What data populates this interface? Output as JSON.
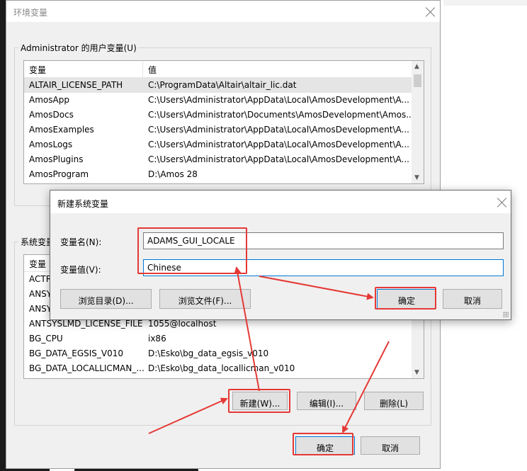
{
  "env_window": {
    "title": "环境变量",
    "user_group_label": "Administrator 的用户变量(U)",
    "system_group_label": "系统变量",
    "columns": [
      "变量",
      "值"
    ],
    "user_vars": [
      {
        "name": "ALTAIR_LICENSE_PATH",
        "value": "C:\\ProgramData\\Altair\\altair_lic.dat"
      },
      {
        "name": "AmosApp",
        "value": "C:\\Users\\Administrator\\AppData\\Local\\AmosDevelopment\\A..."
      },
      {
        "name": "AmosDocs",
        "value": "C:\\Users\\Administrator\\Documents\\AmosDevelopment\\Amos..."
      },
      {
        "name": "AmosExamples",
        "value": "C:\\Users\\Administrator\\AppData\\Local\\AmosDevelopment\\A..."
      },
      {
        "name": "AmosLogs",
        "value": "C:\\Users\\Administrator\\AppData\\Local\\AmosDevelopment\\A..."
      },
      {
        "name": "AmosPlugins",
        "value": "C:\\Users\\Administrator\\AppData\\Local\\AmosDevelopment\\A..."
      },
      {
        "name": "AmosProgram",
        "value": "D:\\Amos 28"
      }
    ],
    "system_header_first": "变量",
    "system_vars_partial": [
      "ACTR",
      "ANSY",
      "ANSY"
    ],
    "system_vars": [
      {
        "name": "ANTSYSLMD_LICENSE_FILE",
        "value": "1055@localhost"
      },
      {
        "name": "BG_CPU",
        "value": "ix86"
      },
      {
        "name": "BG_DATA_EGSIS_V010",
        "value": "D:\\Esko\\bg_data_egsis_v010"
      },
      {
        "name": "BG_DATA_LOCALLICMAN_...",
        "value": "D:\\Esko\\bg_data_locallicman_v010"
      }
    ],
    "buttons": {
      "new": "新建(W)...",
      "edit": "编辑(I)...",
      "delete": "删除(L)",
      "ok": "确定",
      "cancel": "取消"
    }
  },
  "new_var_dialog": {
    "title": "新建系统变量",
    "name_label": "变量名(N):",
    "value_label": "变量值(V):",
    "name_value": "ADAMS_GUI_LOCALE",
    "value_value": "Chinese",
    "buttons": {
      "browse_dir": "浏览目录(D)...",
      "browse_file": "浏览文件(F)...",
      "ok": "确定",
      "cancel": "取消"
    }
  },
  "colors": {
    "annotation": "#e53935",
    "accent": "#0078d7"
  }
}
